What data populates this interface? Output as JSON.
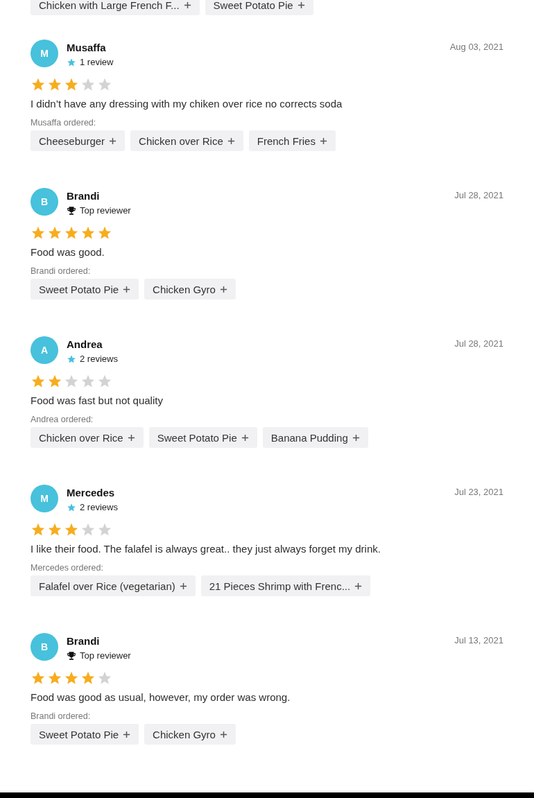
{
  "previous_items": [
    "Chicken with Large French F...",
    "Sweet Potato Pie"
  ],
  "reviews": [
    {
      "initial": "M",
      "name": "Musaffa",
      "badge": {
        "kind": "reviews",
        "text": "1 review"
      },
      "date": "Aug 03, 2021",
      "stars": 3,
      "text": "I didn’t have any dressing with my chiken over rice no corrects soda",
      "ordered_label": "Musaffa ordered:",
      "items": [
        "Cheeseburger",
        "Chicken over Rice",
        "French Fries"
      ]
    },
    {
      "initial": "B",
      "name": "Brandi",
      "badge": {
        "kind": "top",
        "text": "Top reviewer"
      },
      "date": "Jul 28, 2021",
      "stars": 5,
      "text": "Food was good.",
      "ordered_label": "Brandi ordered:",
      "items": [
        "Sweet Potato Pie",
        "Chicken Gyro"
      ]
    },
    {
      "initial": "A",
      "name": "Andrea",
      "badge": {
        "kind": "reviews",
        "text": "2 reviews"
      },
      "date": "Jul 28, 2021",
      "stars": 2,
      "text": "Food was fast but not quality",
      "ordered_label": "Andrea ordered:",
      "items": [
        "Chicken over Rice",
        "Sweet Potato Pie",
        "Banana Pudding"
      ]
    },
    {
      "initial": "M",
      "name": "Mercedes",
      "badge": {
        "kind": "reviews",
        "text": "2 reviews"
      },
      "date": "Jul 23, 2021",
      "stars": 3,
      "text": "I like their food. The falafel is always great.. they just always forget my drink.",
      "ordered_label": "Mercedes ordered:",
      "items": [
        "Falafel over Rice (vegetarian)",
        "21 Pieces Shrimp with Frenc..."
      ]
    },
    {
      "initial": "B",
      "name": "Brandi",
      "badge": {
        "kind": "top",
        "text": "Top reviewer"
      },
      "date": "Jul 13, 2021",
      "stars": 4,
      "text": "Food was good as usual, however, my order was wrong.",
      "ordered_label": "Brandi ordered:",
      "items": [
        "Sweet Potato Pie",
        "Chicken Gyro"
      ]
    }
  ]
}
